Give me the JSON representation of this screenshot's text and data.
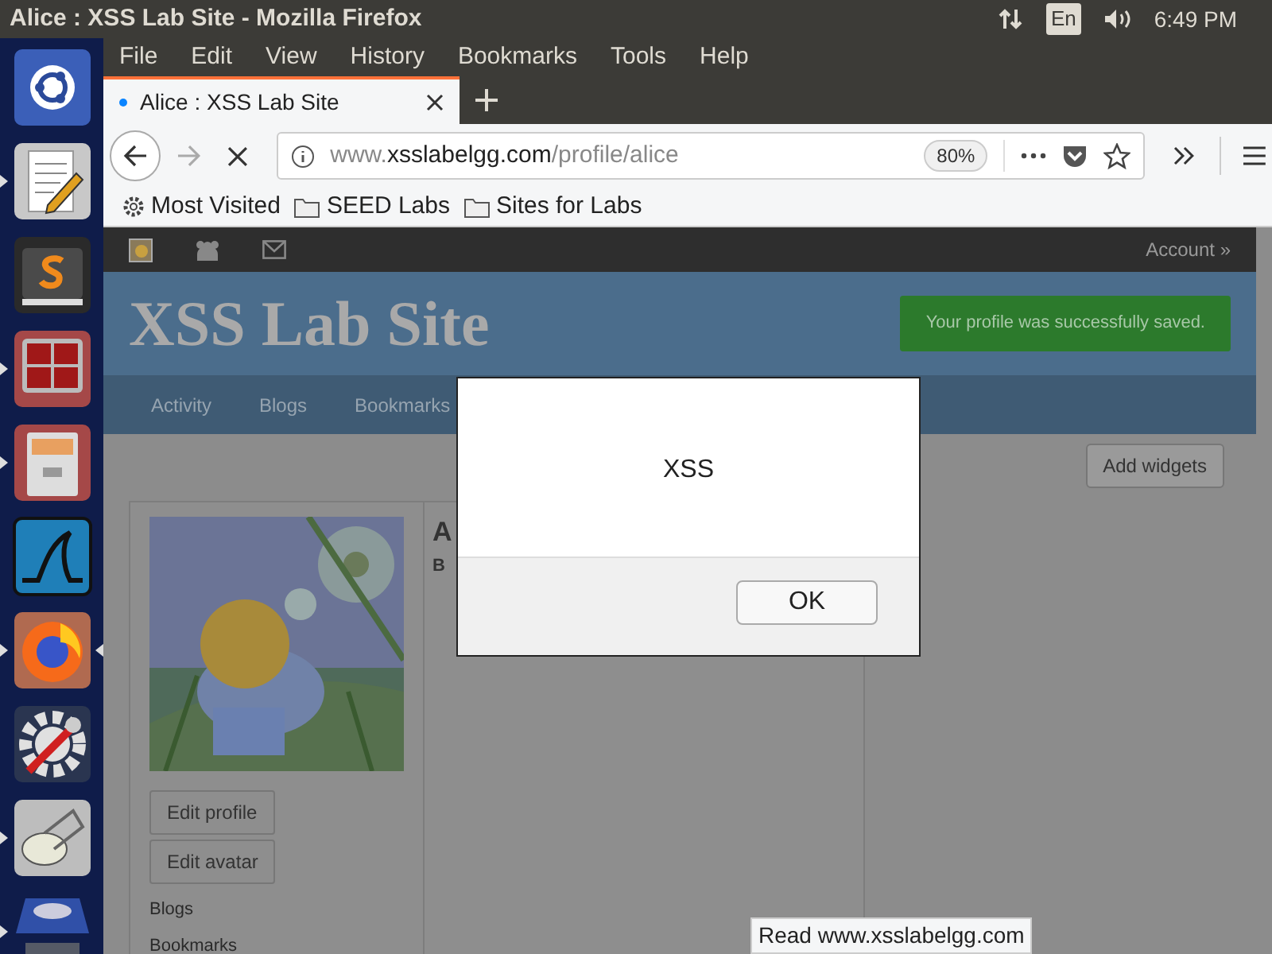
{
  "top_panel": {
    "title": "Alice : XSS Lab Site - Mozilla Firefox",
    "keyboard": "En",
    "time": "6:49 PM"
  },
  "launcher": [
    {
      "kind": "ubuntu",
      "running": false,
      "focused": false
    },
    {
      "kind": "editor",
      "running": true,
      "focused": false
    },
    {
      "kind": "sublime",
      "running": false,
      "focused": false
    },
    {
      "kind": "terminal",
      "running": true,
      "focused": false
    },
    {
      "kind": "files",
      "running": true,
      "focused": false
    },
    {
      "kind": "wireshark",
      "running": false,
      "focused": false
    },
    {
      "kind": "firefox",
      "running": true,
      "focused": true
    },
    {
      "kind": "settings",
      "running": false,
      "focused": false
    },
    {
      "kind": "scanner",
      "running": true,
      "focused": false
    },
    {
      "kind": "dvd",
      "running": true,
      "focused": false
    }
  ],
  "menu": [
    "File",
    "Edit",
    "View",
    "History",
    "Bookmarks",
    "Tools",
    "Help"
  ],
  "tabs": [
    {
      "label": "Alice : XSS Lab Site",
      "selected": true
    }
  ],
  "address": {
    "url": [
      {
        "text": "www.",
        "strong": false
      },
      {
        "text": "xsslabelgg.com",
        "strong": true
      },
      {
        "text": "/profile/alice",
        "strong": false
      }
    ],
    "zoom": "80%"
  },
  "bookmarks": [
    {
      "label": "Most Visited",
      "kind": "gear"
    },
    {
      "label": "SEED Labs",
      "kind": "folder"
    },
    {
      "label": "Sites for Labs",
      "kind": "folder"
    }
  ],
  "site": {
    "account": "Account »",
    "title": "XSS Lab Site",
    "message": "Your profile was successfully saved.",
    "nav": [
      "Activity",
      "Blogs",
      "Bookmarks"
    ],
    "add_widgets": "Add widgets",
    "profile": {
      "buttons": [
        "Edit profile",
        "Edit avatar"
      ],
      "links": [
        "Blogs",
        "Bookmarks"
      ],
      "name": "A",
      "subtitle": "B"
    }
  },
  "dialog": {
    "message": "XSS",
    "button": "OK"
  },
  "status": "Read www.xsslabelgg.com"
}
